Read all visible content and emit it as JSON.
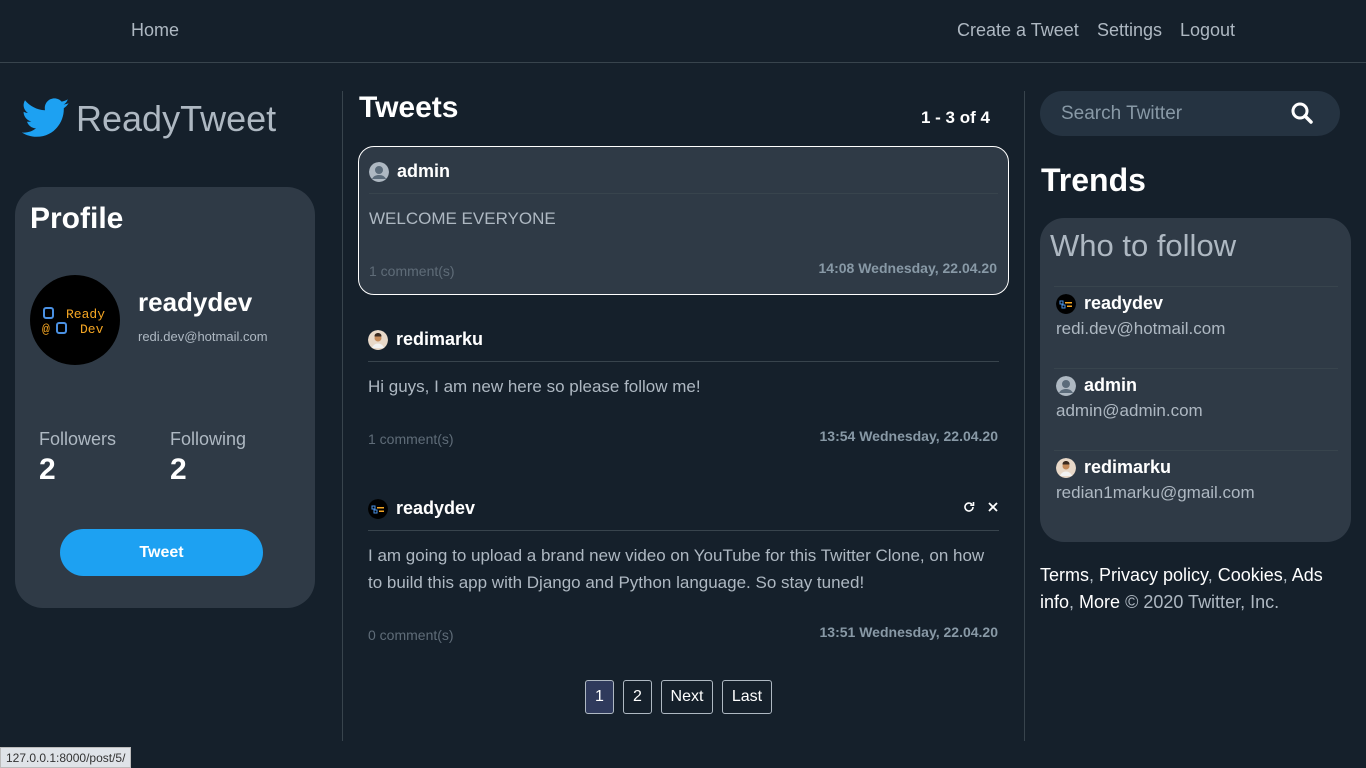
{
  "nav": {
    "home": "Home",
    "create_tweet": "Create a Tweet",
    "settings": "Settings",
    "logout": "Logout"
  },
  "brand": {
    "name": "ReadyTweet",
    "icon": "twitter-bird-icon",
    "color": "#1da1f2"
  },
  "profile": {
    "title": "Profile",
    "username": "readydev",
    "email": "redi.dev@hotmail.com",
    "avatar_logo": "Ready Dev",
    "followers_label": "Followers",
    "followers_count": "2",
    "following_label": "Following",
    "following_count": "2",
    "tweet_button": "Tweet"
  },
  "feed": {
    "title": "Tweets",
    "range": "1 - 3 of 4",
    "tweets": [
      {
        "author": "admin",
        "body": "WELCOME EVERYONE",
        "comments": "1 comment(s)",
        "time": "14:08 Wednesday, 22.04.20"
      },
      {
        "author": "redimarku",
        "body": "Hi guys, I am new here so please follow me!",
        "comments": "1 comment(s)",
        "time": "13:54 Wednesday, 22.04.20"
      },
      {
        "author": "readydev",
        "body": "I am going to upload a brand new video on YouTube for this Twitter Clone, on how to build this app with Django and Python language. So stay tuned!",
        "comments": "0 comment(s)",
        "time": "13:51 Wednesday, 22.04.20",
        "actions": [
          "refresh-icon",
          "close-icon"
        ]
      }
    ],
    "pagination": {
      "page1": "1",
      "page2": "2",
      "next": "Next",
      "last": "Last",
      "current": "1"
    }
  },
  "sidebar": {
    "search_placeholder": "Search Twitter",
    "trends_title": "Trends",
    "who_to_follow_title": "Who to follow",
    "suggestions": [
      {
        "name": "readydev",
        "email": "redi.dev@hotmail.com"
      },
      {
        "name": "admin",
        "email": "admin@admin.com"
      },
      {
        "name": "redimarku",
        "email": "redian1marku@gmail.com"
      }
    ]
  },
  "footer": {
    "terms": "Terms",
    "privacy": "Privacy policy",
    "cookies": "Cookies",
    "ads": "Ads info",
    "more": "More",
    "copyright": "© 2020 Twitter, Inc."
  },
  "status_url": "127.0.0.1:8000/post/5/",
  "colors": {
    "background": "#15202b",
    "card": "#2f3a46",
    "accent": "#1da1f2",
    "muted_text": "#aeb8c2"
  }
}
